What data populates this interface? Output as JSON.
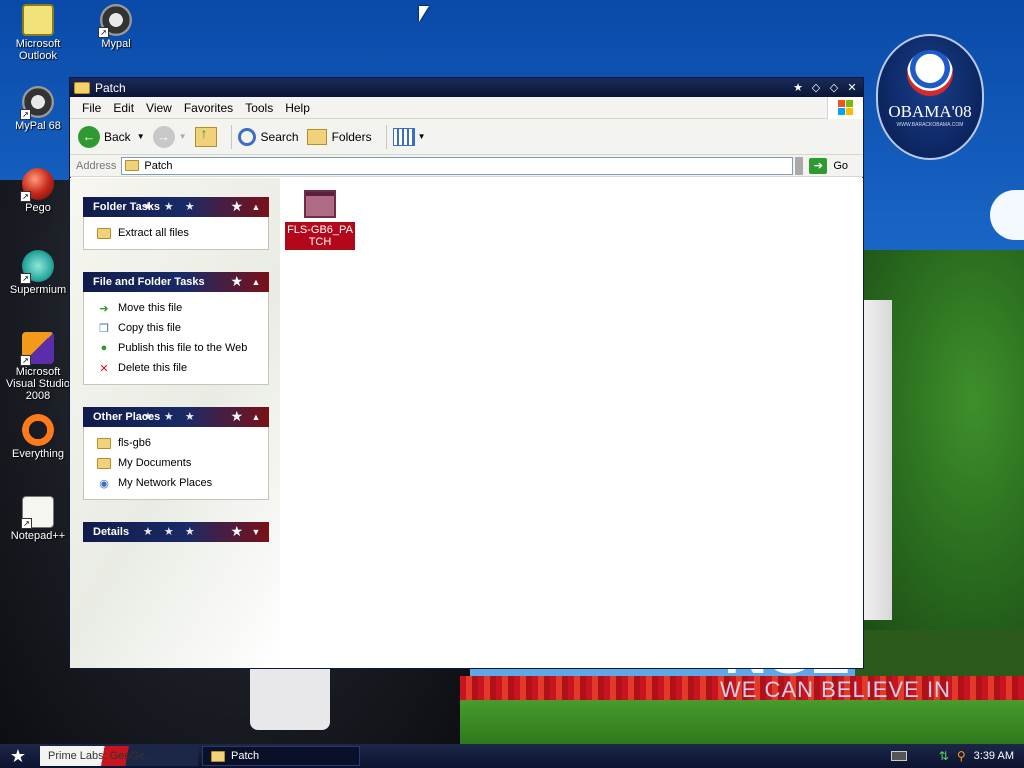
{
  "desktop": {
    "icons": [
      {
        "label": "Microsoft Outlook",
        "icon": "outlook-icon"
      },
      {
        "label": "Mypal",
        "icon": "mypal-icon"
      },
      {
        "label": "MyPal 68",
        "icon": "mypal68-icon"
      },
      {
        "label": "Pego",
        "icon": "pego-icon"
      },
      {
        "label": "Supermium",
        "icon": "supermium-icon"
      },
      {
        "label": "Microsoft Visual Studio 2008",
        "icon": "visual-studio-icon"
      },
      {
        "label": "Everything",
        "icon": "everything-icon"
      },
      {
        "label": "Notepad++",
        "icon": "notepadpp-icon"
      }
    ],
    "wallpaper": {
      "badge_text": "OBAMA'08",
      "badge_sub": "WWW.BARACKOBAMA.COM",
      "slogan_big": "NGE",
      "slogan_small": "WE CAN BELIEVE IN"
    }
  },
  "window": {
    "title": "Patch",
    "menu": [
      "File",
      "Edit",
      "View",
      "Favorites",
      "Tools",
      "Help"
    ],
    "toolbar": {
      "back": "Back",
      "search": "Search",
      "folders": "Folders"
    },
    "address": {
      "label": "Address",
      "value": "Patch",
      "go": "Go"
    },
    "panels": {
      "folder_tasks": {
        "title": "Folder Tasks",
        "items": [
          "Extract all files"
        ]
      },
      "file_tasks": {
        "title": "File and Folder Tasks",
        "items": [
          "Move this file",
          "Copy this file",
          "Publish this file to the Web",
          "Delete this file"
        ]
      },
      "other_places": {
        "title": "Other Places",
        "items": [
          "fls-gb6",
          "My Documents",
          "My Network Places"
        ]
      },
      "details": {
        "title": "Details"
      }
    },
    "files": [
      {
        "name": "FLS-GB6_PATCH",
        "selected": true
      }
    ]
  },
  "taskbar": {
    "tasks": [
      {
        "label": "Prime Labs: GeoGe..."
      },
      {
        "label": "Patch"
      }
    ],
    "clock": "3:39 AM"
  },
  "colors": {
    "panel_head_blue": "#0f1c4a",
    "panel_head_red": "#7a1018",
    "selection": "#b3081c",
    "taskbar": "#0c1330"
  }
}
